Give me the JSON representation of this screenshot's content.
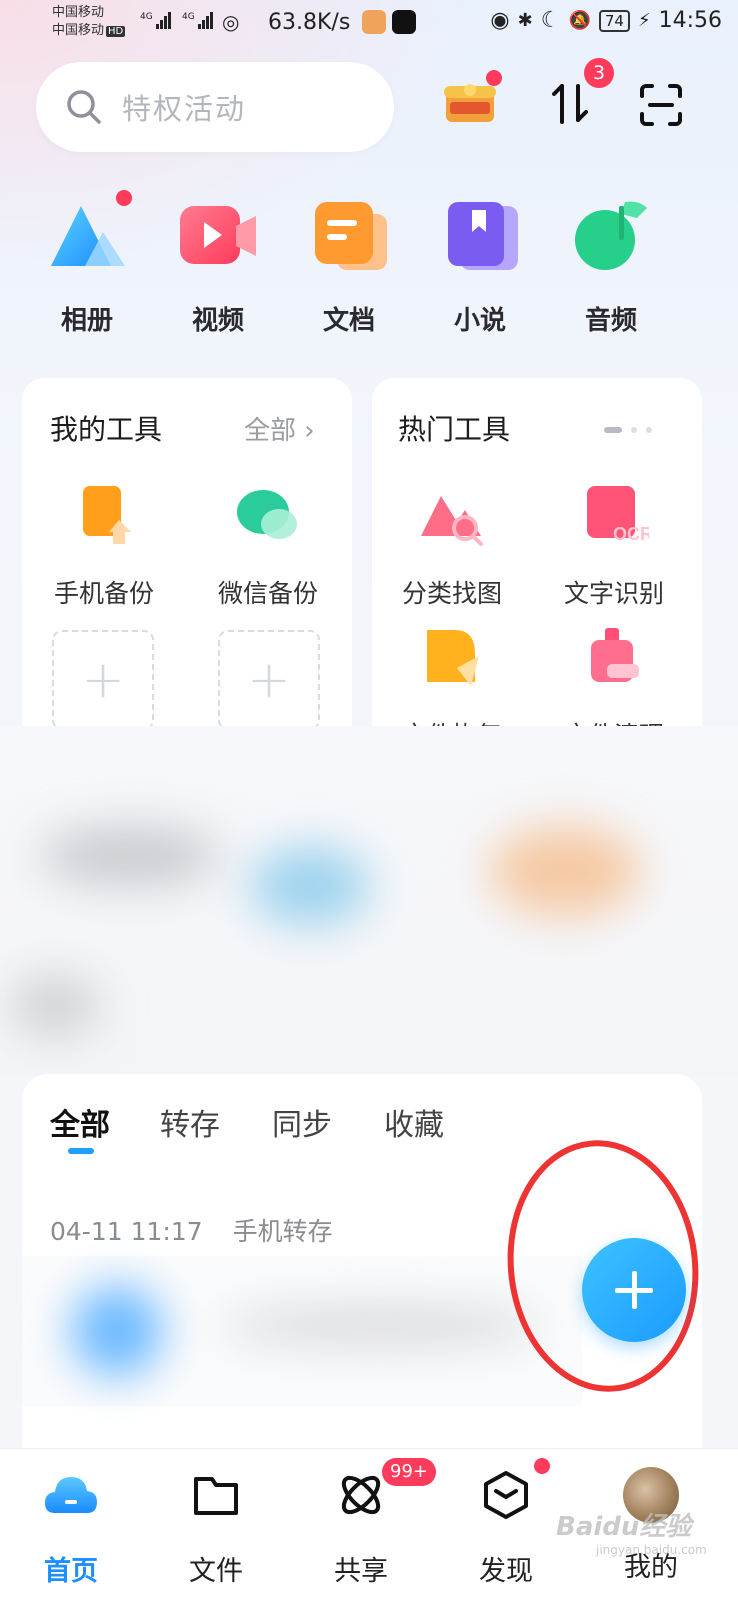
{
  "status_bar": {
    "carrier1": "中国移动",
    "carrier2": "中国移动",
    "hd": "HD",
    "net1": "4G",
    "net2": "4G",
    "speed": "63.8K/s",
    "battery": "74",
    "time": "14:56"
  },
  "search": {
    "placeholder": "特权活动"
  },
  "header": {
    "transfer_badge": "3"
  },
  "categories": [
    {
      "label": "相册",
      "icon": "album-icon"
    },
    {
      "label": "视频",
      "icon": "video-icon"
    },
    {
      "label": "文档",
      "icon": "document-icon"
    },
    {
      "label": "小说",
      "icon": "novel-icon"
    },
    {
      "label": "音频",
      "icon": "audio-icon"
    }
  ],
  "my_tools": {
    "title": "我的工具",
    "all_label": "全部",
    "items": [
      {
        "label": "手机备份",
        "icon": "phone-backup-icon"
      },
      {
        "label": "微信备份",
        "icon": "wechat-backup-icon"
      }
    ],
    "add_label": "+"
  },
  "hot_tools": {
    "title": "热门工具",
    "items": [
      {
        "label": "分类找图",
        "icon": "find-image-icon"
      },
      {
        "label": "文字识别",
        "icon": "ocr-icon"
      },
      {
        "label": "文件恢复",
        "icon": "file-recovery-icon"
      },
      {
        "label": "文件清理",
        "icon": "file-cleanup-icon"
      }
    ],
    "ocr_text": "OCR"
  },
  "list": {
    "tabs": [
      "全部",
      "转存",
      "同步",
      "收藏"
    ],
    "active_tab": 0,
    "date": "04-11 11:17",
    "source": "手机转存"
  },
  "bottom_nav": {
    "items": [
      {
        "label": "首页",
        "icon": "home-cloud-icon"
      },
      {
        "label": "文件",
        "icon": "folder-icon"
      },
      {
        "label": "共享",
        "icon": "share-orbit-icon"
      },
      {
        "label": "发现",
        "icon": "discover-cube-icon"
      },
      {
        "label": "我的",
        "icon": "avatar"
      }
    ],
    "share_badge": "99+"
  },
  "watermark": {
    "main": "Baidu经验",
    "sub": "jingyan.baidu.com"
  },
  "colors": {
    "accent": "#1e8fff",
    "badge": "#ff3b5c",
    "annotation": "#e33333"
  }
}
